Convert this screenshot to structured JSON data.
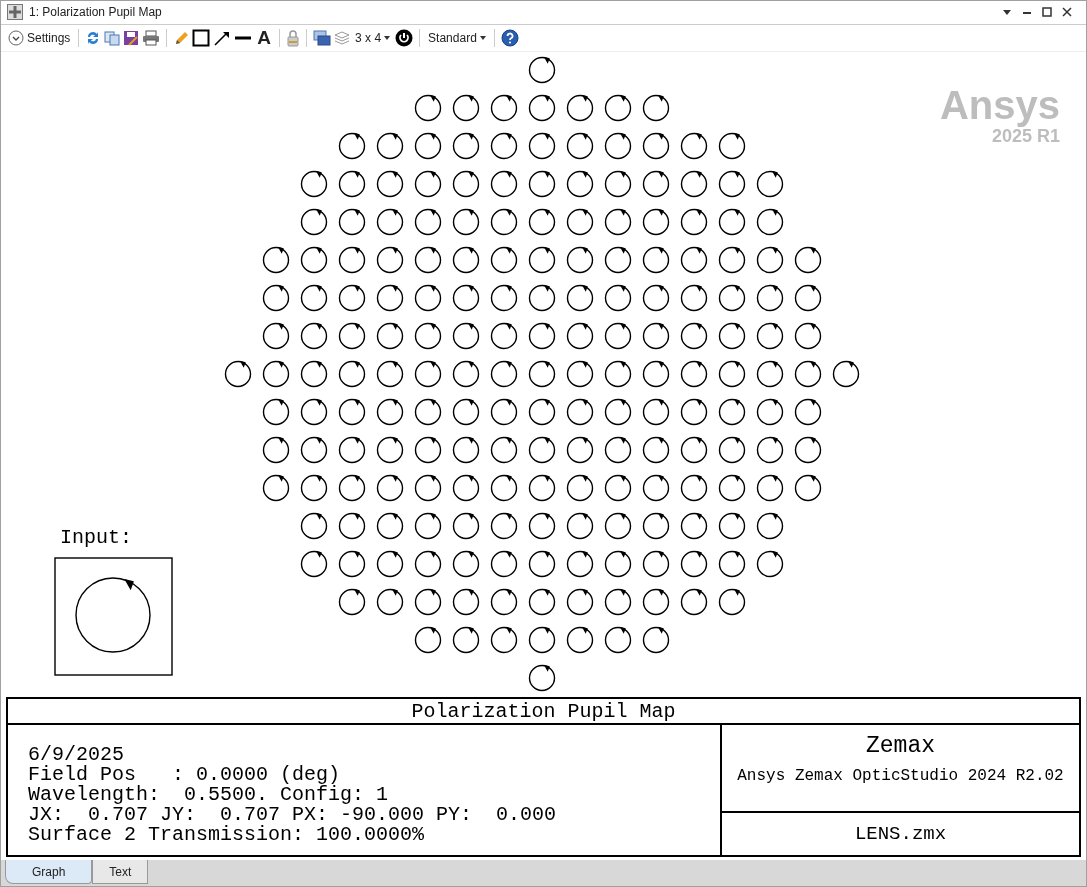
{
  "window": {
    "title": "1: Polarization Pupil Map"
  },
  "toolbar": {
    "settings_label": "Settings",
    "text_tool": "A",
    "layout": "3 x 4",
    "style": "Standard"
  },
  "plot": {
    "watermark": [
      "Ansys",
      "2025 R1"
    ],
    "input_label": "Input:"
  },
  "info": {
    "title": "Polarization Pupil Map",
    "lines": [
      "6/9/2025",
      "Field Pos   : 0.0000 (deg)",
      "Wavelength:  0.5500. Config: 1",
      "JX:  0.707 JY:  0.707 PX: -90.000 PY:  0.000",
      "Surface 2 Transmission: 100.0000%"
    ],
    "company": "Zemax",
    "product": "Ansys Zemax OpticStudio 2024 R2.02",
    "file": "LENS.zmx"
  },
  "tabs": [
    {
      "label": "Graph",
      "selected": true
    },
    {
      "label": "Text",
      "selected": false
    }
  ]
}
